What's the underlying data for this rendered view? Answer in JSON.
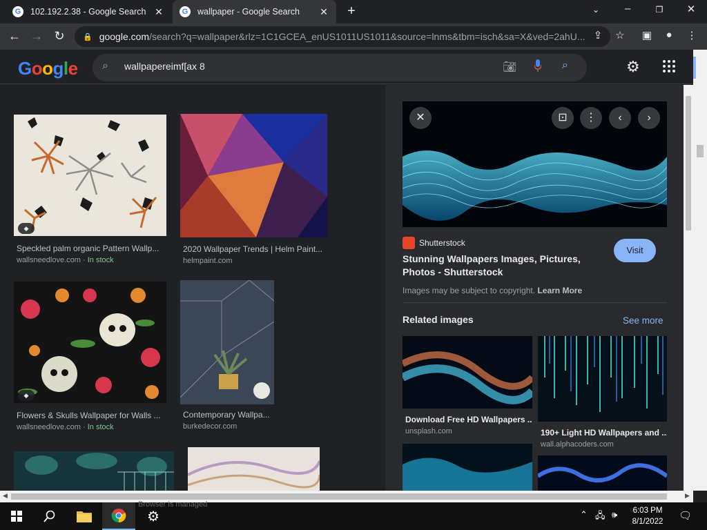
{
  "browser": {
    "tabs": [
      {
        "title": "102.192.2.38 - Google Search",
        "active": false
      },
      {
        "title": "wallpaper - Google Search",
        "active": true
      }
    ],
    "new_tab_symbol": "+",
    "close_symbol": "✕",
    "url_host": "google.com",
    "url_rest": "/search?q=wallpaper&rlz=1C1GCEA_enUS1011US1011&source=lnms&tbm=isch&sa=X&ved=2ahU..."
  },
  "google": {
    "logo": "Google",
    "search_value": "wallpapereimf[ax 8"
  },
  "results": [
    {
      "title": "Speckled palm organic Pattern Wallp...",
      "source": "wallsneedlove.com",
      "stock": "In stock"
    },
    {
      "title": "2020 Wallpaper Trends | Helm Paint...",
      "source": "helmpaint.com",
      "stock": ""
    },
    {
      "title": "Flowers & Skulls Wallpaper for Walls ...",
      "source": "wallsneedlove.com",
      "stock": "In stock"
    },
    {
      "title": "Contemporary Wallpa...",
      "source": "burkedecor.com",
      "stock": ""
    }
  ],
  "panel": {
    "source_name": "Shutterstock",
    "visit_label": "Visit",
    "title": "Stunning Wallpapers Images, Pictures, Photos - Shutterstock",
    "copyright_text": "Images may be subject to copyright.",
    "learn_more": "Learn More",
    "related_title": "Related images",
    "see_more": "See more",
    "related": [
      {
        "title": "Download Free HD Wallpapers ...",
        "source": "unsplash.com"
      },
      {
        "title": "190+ Light HD Wallpapers and ...",
        "source": "wall.alphacoders.com"
      }
    ]
  },
  "taskbar": {
    "managed_text": "Browser is managed",
    "time": "6:03 PM",
    "date": "8/1/2022"
  },
  "colors": {
    "accent": "#8ab4f8",
    "in_stock": "#81c995",
    "background": "#202124",
    "panel": "#292a2d"
  }
}
